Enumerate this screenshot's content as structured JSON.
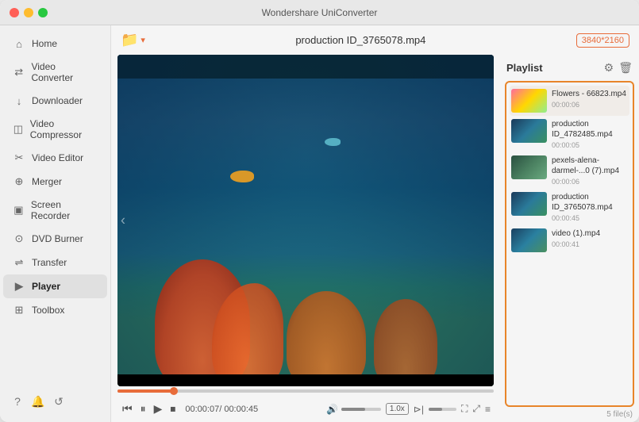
{
  "app": {
    "title": "Wondershare UniConverter"
  },
  "titlebar": {
    "title": "Wondershare UniConverter"
  },
  "sidebar": {
    "items": [
      {
        "id": "home",
        "label": "Home",
        "icon": "⌂"
      },
      {
        "id": "video-converter",
        "label": "Video Converter",
        "icon": "⇄"
      },
      {
        "id": "downloader",
        "label": "Downloader",
        "icon": "↓"
      },
      {
        "id": "video-compressor",
        "label": "Video Compressor",
        "icon": "◫"
      },
      {
        "id": "video-editor",
        "label": "Video Editor",
        "icon": "✂"
      },
      {
        "id": "merger",
        "label": "Merger",
        "icon": "⊕"
      },
      {
        "id": "screen-recorder",
        "label": "Screen Recorder",
        "icon": "▣"
      },
      {
        "id": "dvd-burner",
        "label": "DVD Burner",
        "icon": "⊙"
      },
      {
        "id": "transfer",
        "label": "Transfer",
        "icon": "⇌"
      },
      {
        "id": "player",
        "label": "Player",
        "icon": "▶",
        "active": true
      },
      {
        "id": "toolbox",
        "label": "Toolbox",
        "icon": "⊞"
      }
    ],
    "bottom_icons": [
      "?",
      "🔔",
      "↺"
    ]
  },
  "header": {
    "filename": "production ID_3765078.mp4",
    "resolution": "3840*2160",
    "add_button_label": "+"
  },
  "player": {
    "current_time": "00:00:07",
    "total_time": "00:00:45",
    "time_display": "00:00:07/ 00:00:45",
    "speed": "1.0x",
    "scrubber_percent": 15
  },
  "playlist": {
    "title": "Playlist",
    "file_count": "5 file(s)",
    "items": [
      {
        "name": "Flowers - 66823.mp4",
        "duration": "00:00:06",
        "thumb_class": "thumb-flowers",
        "active": true
      },
      {
        "name": "production ID_4782485.mp4",
        "duration": "00:00:05",
        "thumb_class": "thumb-prod"
      },
      {
        "name": "pexels-alena-darmel-...0 (7).mp4",
        "duration": "00:00:06",
        "thumb_class": "thumb-alena"
      },
      {
        "name": "production ID_3765078.mp4",
        "duration": "00:00:45",
        "thumb_class": "thumb-prod"
      },
      {
        "name": "video (1).mp4",
        "duration": "00:00:41",
        "thumb_class": "thumb-video"
      }
    ]
  }
}
